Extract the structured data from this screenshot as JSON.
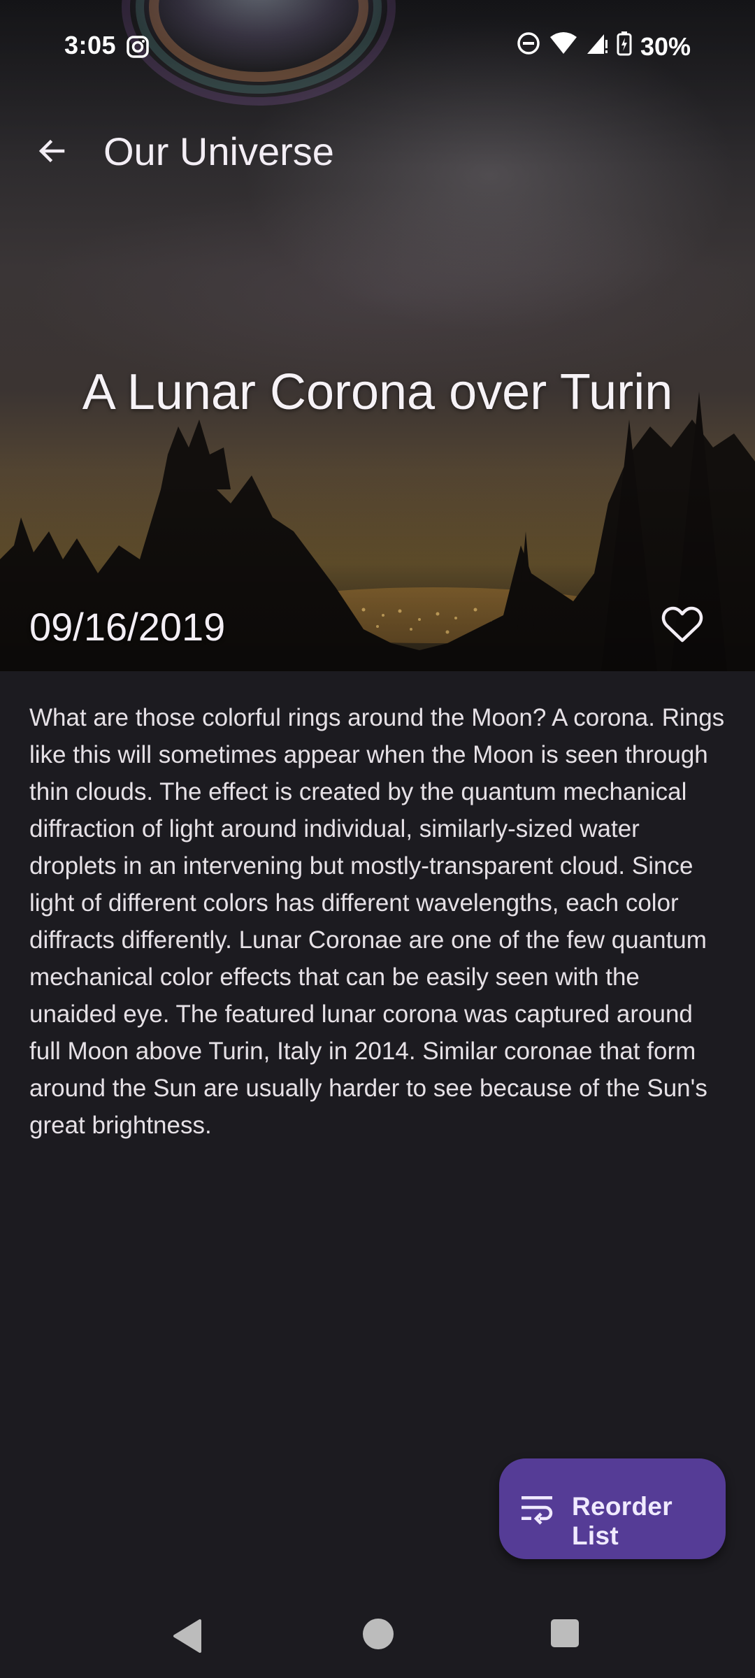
{
  "status_bar": {
    "time": "3:05",
    "battery": "30%",
    "icons": [
      "instagram-icon",
      "do-not-disturb-icon",
      "wifi-icon",
      "cell-signal-icon",
      "battery-charging-icon"
    ]
  },
  "app_bar": {
    "title": "Our Universe",
    "back_icon": "arrow-back-icon"
  },
  "photo": {
    "title": "A Lunar Corona over Turin",
    "date": "09/16/2019",
    "favorite_icon": "heart-outline-icon",
    "description": "What are those colorful rings around the Moon? A corona. Rings like this will sometimes appear when the Moon is seen through thin clouds. The effect is created by the quantum mechanical diffraction of light around individual, similarly-sized water droplets in an intervening but mostly-transparent cloud. Since light of different colors has different wavelengths, each color diffracts differently. Lunar Coronae are one of the few  quantum mechanical color effects that can be easily seen with the unaided eye.  The featured lunar corona was captured around full Moon above Turin, Italy in 2014.  Similar coronae that form around the Sun are usually harder to see because of the Sun's great brightness."
  },
  "fab": {
    "label": "Reorder List",
    "icon": "reorder-icon"
  },
  "nav_bar": {
    "icons": [
      "nav-back-icon",
      "nav-home-icon",
      "nav-recents-icon"
    ]
  },
  "colors": {
    "background": "#1c1b20",
    "fab": "#553c96",
    "text": "#e6e1e6"
  }
}
